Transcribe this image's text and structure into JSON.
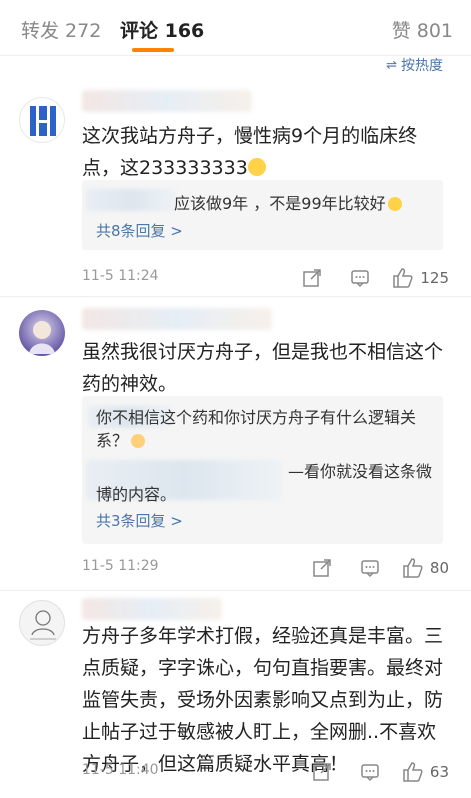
{
  "tabs": {
    "repost": "转发 272",
    "comments": "评论 166",
    "likes": "赞 801"
  },
  "sort": {
    "icon": "sort-lines-icon",
    "label": "按热度"
  },
  "comments": [
    {
      "avatar_icon": "logo-avatar",
      "text": "这次我站方舟子，慢性病9个月的临床终点，这233333333",
      "emoji": "smile-emoji",
      "replies": [
        {
          "visible_text": "应该做9年 ，不是99年比较好",
          "emoji": "tearful-emoji"
        }
      ],
      "more_replies": "共8条回复 >",
      "time": "11-5 11:24",
      "like_count": "125"
    },
    {
      "avatar_icon": "anime-avatar",
      "text": "虽然我很讨厌方舟子，但是我也不相信这个药的神效。",
      "replies": [
        {
          "visible_text": "你不相信这个药和你讨厌方舟子有什么逻辑关系？",
          "emoji": "cross-emoji"
        },
        {
          "visible_text": "—看你就没看这条微博的内容。"
        }
      ],
      "more_replies": "共3条回复 >",
      "time": "11-5 11:29",
      "like_count": "80"
    },
    {
      "avatar_icon": "sketch-avatar",
      "text": "方舟子多年学术打假，经验还真是丰富。三点质疑，字字诛心，句句直指要害。最终对监管失责，受场外因素影响又点到为止，防止帖子过于敏感被人盯上，全网删..不喜欢方舟子，但这篇质疑水平真高！",
      "time": "11-5 11:40",
      "like_count": "63"
    }
  ]
}
